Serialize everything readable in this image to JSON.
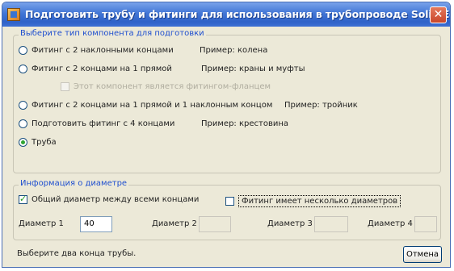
{
  "window": {
    "title": "Подготовить трубу и фитинги для использования в трубопроводе Solid Edge",
    "close_glyph": "✕"
  },
  "component_type": {
    "legend": "Выберите тип компонента для подготовки",
    "options": [
      {
        "label": "Фитинг с 2 наклонными концами",
        "example": "Пример: колена",
        "selected": false
      },
      {
        "label": "Фитинг с 2 концами на 1 прямой",
        "example": "Пример: краны и муфты",
        "selected": false
      },
      {
        "label": "Фитинг с 2 концами на 1 прямой и 1 наклонным концом",
        "example": "Пример: тройник",
        "selected": false
      },
      {
        "label": "Подготовить фитинг с 4 концами",
        "example": "Пример: крестовина",
        "selected": false
      },
      {
        "label": "Труба",
        "example": "",
        "selected": true
      }
    ],
    "sub_option": {
      "label": "Этот компонент является фитингом-фланцем",
      "checked": false,
      "enabled": false
    }
  },
  "diameter_info": {
    "legend": "Информация о диаметре",
    "common_diameter": {
      "label": "Общий диаметр между всеми концами",
      "checked": true
    },
    "multiple_diameters": {
      "label": "Фитинг имеет несколько диаметров",
      "checked": false
    },
    "fields": [
      {
        "label": "Диаметр 1",
        "value": "40",
        "enabled": true
      },
      {
        "label": "Диаметр 2",
        "value": "",
        "enabled": false
      },
      {
        "label": "Диаметр 3",
        "value": "",
        "enabled": false
      },
      {
        "label": "Диаметр 4",
        "value": "",
        "enabled": false
      }
    ]
  },
  "status": {
    "text": "Выберите два конца трубы."
  },
  "buttons": {
    "cancel": "Отмена"
  }
}
